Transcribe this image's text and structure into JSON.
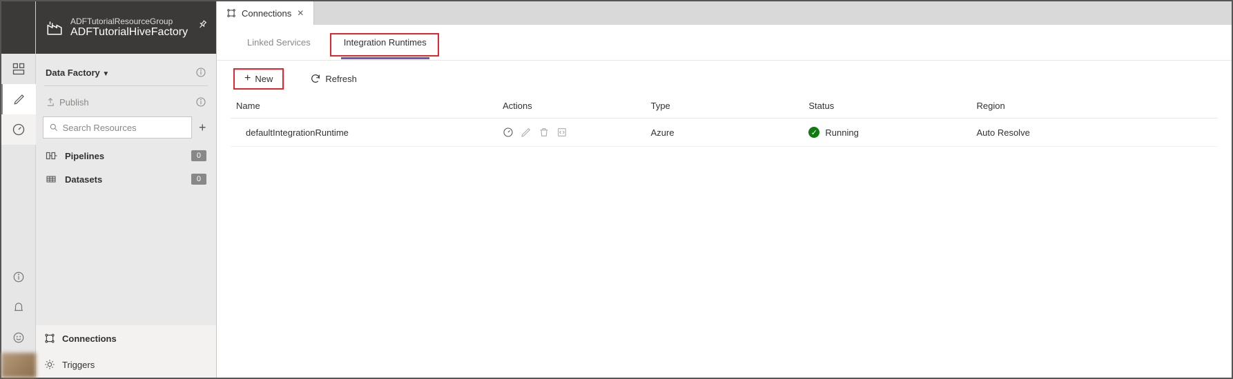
{
  "header": {
    "resource_group": "ADFTutorialResourceGroup",
    "factory_name": "ADFTutorialHiveFactory"
  },
  "sidebar": {
    "section_label": "Data Factory",
    "publish_label": "Publish",
    "search_placeholder": "Search Resources",
    "tree": {
      "pipelines": {
        "label": "Pipelines",
        "count": "0"
      },
      "datasets": {
        "label": "Datasets",
        "count": "0"
      }
    },
    "footer": {
      "connections": "Connections",
      "triggers": "Triggers"
    }
  },
  "main": {
    "tab_title": "Connections",
    "subtabs": {
      "linked_services": "Linked Services",
      "integration_runtimes": "Integration Runtimes"
    },
    "toolbar": {
      "new_label": "New",
      "refresh_label": "Refresh"
    },
    "table": {
      "headers": {
        "name": "Name",
        "actions": "Actions",
        "type": "Type",
        "status": "Status",
        "region": "Region"
      },
      "rows": [
        {
          "name": "defaultIntegrationRuntime",
          "type": "Azure",
          "status": "Running",
          "region": "Auto Resolve"
        }
      ]
    }
  }
}
